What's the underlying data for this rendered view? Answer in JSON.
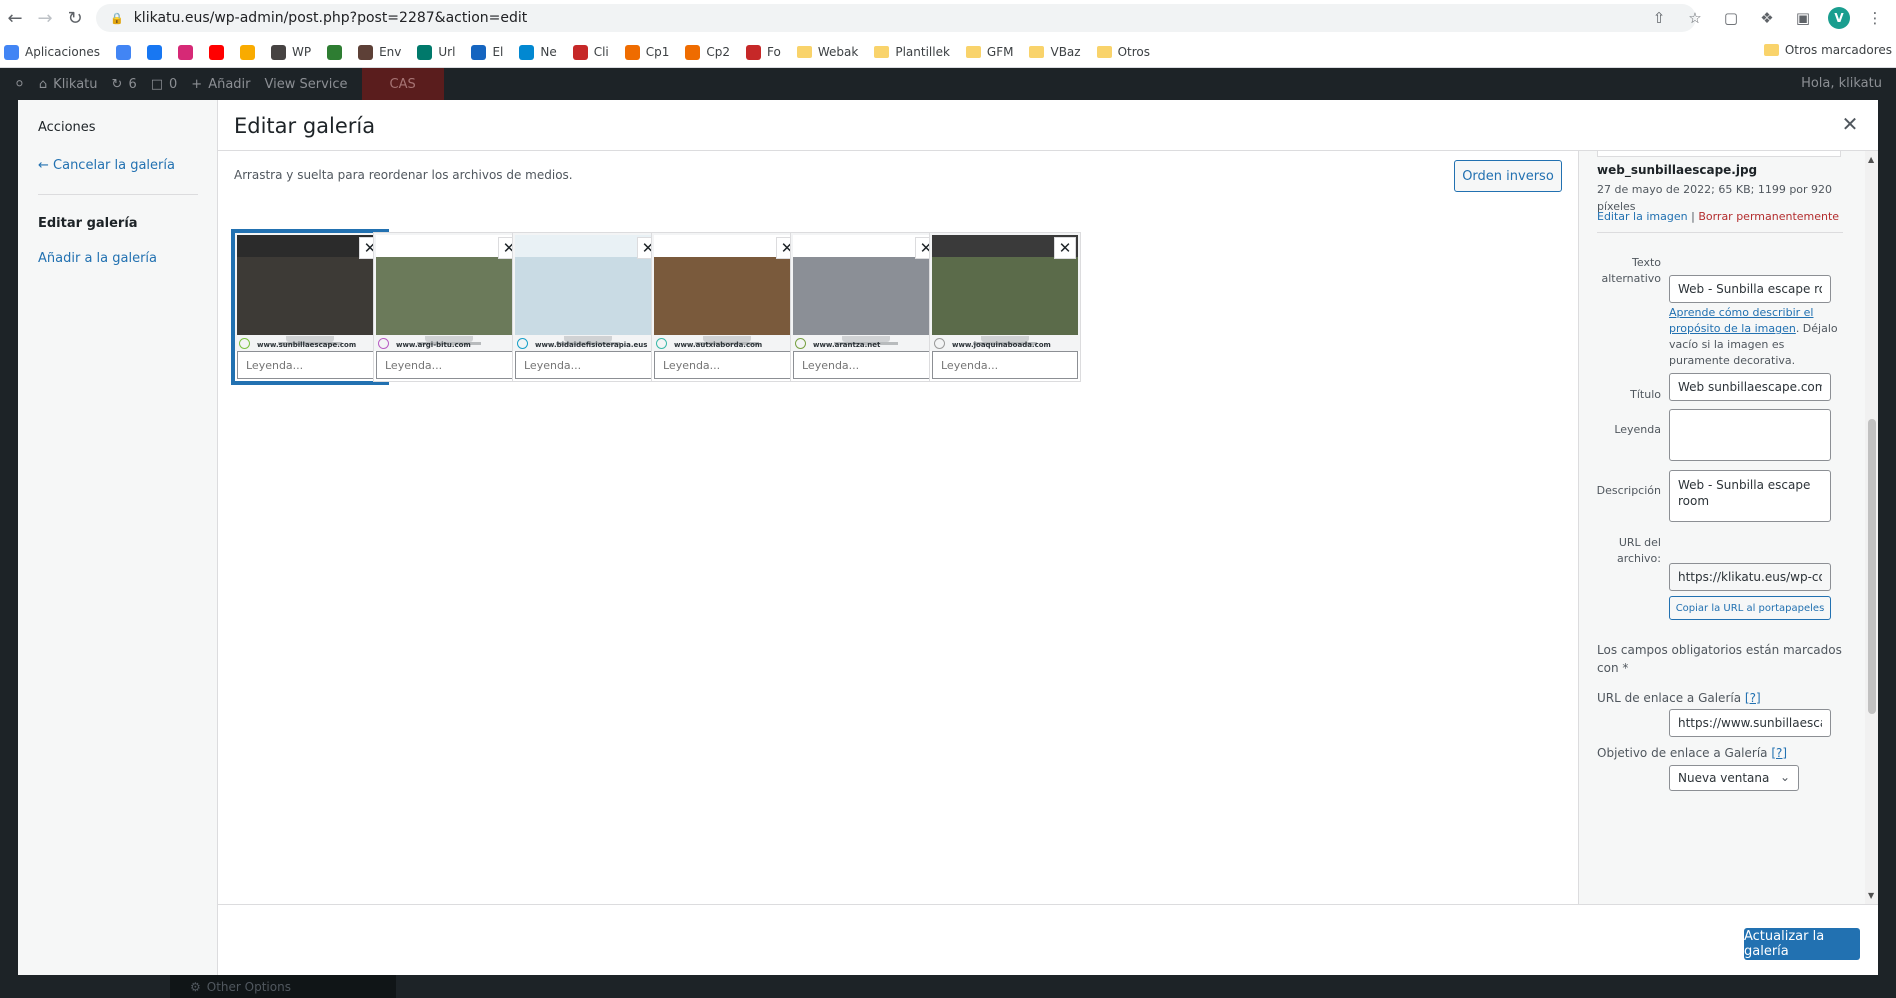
{
  "browser": {
    "url": "klikatu.eus/wp-admin/post.php?post=2287&action=edit",
    "profile_initial": "V",
    "bookmarks": [
      {
        "label": "Aplicaciones",
        "icon": "apps-grid-icon",
        "color": "#4285f4"
      },
      {
        "label": "",
        "icon": "google-icon",
        "color": "#4285f4"
      },
      {
        "label": "",
        "icon": "facebook-icon",
        "color": "#1877f2"
      },
      {
        "label": "",
        "icon": "instagram-icon",
        "color": "#d62976"
      },
      {
        "label": "",
        "icon": "youtube-icon",
        "color": "#ff0000"
      },
      {
        "label": "",
        "icon": "analytics-icon",
        "color": "#f9ab00"
      },
      {
        "label": "WP",
        "icon": "wordpress-icon",
        "color": "#464342"
      },
      {
        "label": "",
        "icon": "leaf-icon",
        "color": "#2e7d32"
      },
      {
        "label": "Env",
        "icon": "env-icon",
        "color": "#5d4037"
      },
      {
        "label": "Url",
        "icon": "code-icon",
        "color": "#00796b"
      },
      {
        "label": "El",
        "icon": "el-icon",
        "color": "#1565c0"
      },
      {
        "label": "Ne",
        "icon": "ne-icon",
        "color": "#0288d1"
      },
      {
        "label": "Cli",
        "icon": "cli-icon",
        "color": "#c62828"
      },
      {
        "label": "Cp1",
        "icon": "cp1-icon",
        "color": "#ef6c00"
      },
      {
        "label": "Cp2",
        "icon": "cp2-icon",
        "color": "#ef6c00"
      },
      {
        "label": "Fo",
        "icon": "fo-icon",
        "color": "#c62828"
      },
      {
        "label": "Webak",
        "icon": "folder-icon",
        "color": "#f9d36b"
      },
      {
        "label": "Plantillek",
        "icon": "folder-icon",
        "color": "#f9d36b"
      },
      {
        "label": "GFM",
        "icon": "folder-icon",
        "color": "#f9d36b"
      },
      {
        "label": "VBaz",
        "icon": "folder-icon",
        "color": "#f9d36b"
      },
      {
        "label": "Otros",
        "icon": "folder-icon",
        "color": "#f9d36b"
      }
    ],
    "other_bookmarks": "Otros marcadores"
  },
  "admin_bar": {
    "site": "Klikatu",
    "updates": "6",
    "comments": "0",
    "add_new": "Añadir",
    "view_service": "View Service",
    "cas": "CAS",
    "howdy": "Hola, klikatu",
    "other_options": "Other Options"
  },
  "modal": {
    "title": "Editar galería",
    "menu": {
      "actions": "Acciones",
      "cancel": "← Cancelar la galería",
      "edit": "Editar galería",
      "add": "Añadir a la galería"
    },
    "instructions": "Arrastra y suelta para reordenar los archivos de medios.",
    "reverse_order": "Orden inverso",
    "caption_placeholder": "Leyenda...",
    "thumbnails": [
      {
        "site": "www.sunbillaescape.com",
        "top": "#2b2b2b",
        "bottom": "#3d3a36",
        "accent": "#7cc242"
      },
      {
        "site": "www.argi-bitu.com",
        "top": "#ffffff",
        "bottom": "#6b7a5a",
        "accent": "#b85cc4"
      },
      {
        "site": "www.bidaidefisioterapia.eus",
        "top": "#e9f1f5",
        "bottom": "#c9dbe4",
        "accent": "#1aa0c8"
      },
      {
        "site": "www.autxiaborda.com",
        "top": "#ffffff",
        "bottom": "#7a5a3c",
        "accent": "#3ab8a8"
      },
      {
        "site": "www.arantza.net",
        "top": "#ffffff",
        "bottom": "#8b8f96",
        "accent": "#77a142"
      },
      {
        "site": "www.joaquinaboada.com",
        "top": "#3a3a3a",
        "bottom": "#5b6b4a",
        "accent": "#9b9b9b"
      }
    ],
    "update_button": "Actualizar la galería"
  },
  "details": {
    "filename": "web_sunbillaescape.jpg",
    "meta": "27 de mayo de 2022; 65 KB; 1199 por 920 píxeles",
    "edit_image": "Editar la imagen",
    "separator": "|",
    "delete": "Borrar permanentemente",
    "alt_label": "Texto alternativo",
    "alt_value": "Web - Sunbilla escape room",
    "alt_help_link": "Aprende cómo describir el propósito de la imagen",
    "alt_help_text": ". Déjalo vacío si la imagen es puramente decorativa.",
    "title_label": "Título",
    "title_value": "Web sunbillaescape.com",
    "caption_label": "Leyenda",
    "caption_value": "",
    "description_label": "Descripción",
    "description_value": "Web - Sunbilla escape room",
    "file_url_label": "URL del archivo:",
    "file_url_value": "https://klikatu.eus/wp-content/uploads/web_sunbillaescape.jpg",
    "copy_url": "Copiar la URL al portapapeles",
    "required_note": "Los campos obligatorios están marcados con *",
    "link_url_label": "URL de enlace a Galería",
    "link_url_value": "https://www.sunbillaescape.com",
    "link_target_label": "Objetivo de enlace a Galería",
    "help": "[?]",
    "link_target_value": "Nueva ventana"
  }
}
